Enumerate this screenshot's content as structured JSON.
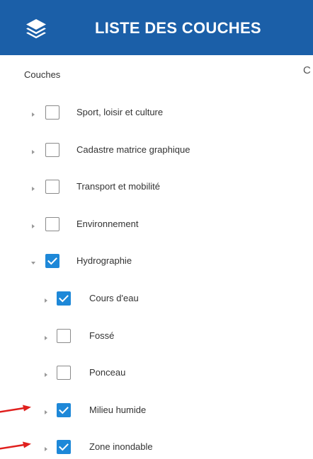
{
  "header": {
    "title": "LISTE DES COUCHES",
    "icon": "layers-icon",
    "background": "#1b5fa8"
  },
  "section_label": "Couches",
  "clipped_text": "C",
  "layers": [
    {
      "label": "Sport, loisir et culture",
      "checked": false,
      "expanded": false,
      "level": 0
    },
    {
      "label": "Cadastre matrice graphique",
      "checked": false,
      "expanded": false,
      "level": 0
    },
    {
      "label": "Transport et mobilité",
      "checked": false,
      "expanded": false,
      "level": 0
    },
    {
      "label": "Environnement",
      "checked": false,
      "expanded": false,
      "level": 0
    },
    {
      "label": "Hydrographie",
      "checked": true,
      "expanded": true,
      "level": 0
    },
    {
      "label": "Cours d'eau",
      "checked": true,
      "expanded": false,
      "level": 1
    },
    {
      "label": "Fossé",
      "checked": false,
      "expanded": false,
      "level": 1
    },
    {
      "label": "Ponceau",
      "checked": false,
      "expanded": false,
      "level": 1
    },
    {
      "label": "Milieu humide",
      "checked": true,
      "expanded": false,
      "level": 1,
      "annotated": true
    },
    {
      "label": "Zone inondable",
      "checked": true,
      "expanded": false,
      "level": 1,
      "annotated": true
    }
  ],
  "colors": {
    "checkbox_checked": "#1e88d8",
    "annotation_arrow": "#e0201e"
  }
}
